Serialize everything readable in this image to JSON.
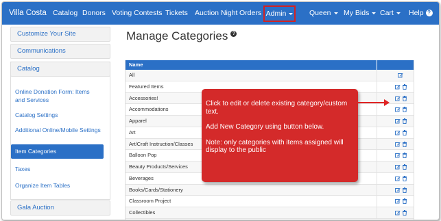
{
  "navbar": {
    "brand": "Villa Costa",
    "items": [
      "Catalog",
      "Donors",
      "Voting Contests",
      "Tickets",
      "Auction Night",
      "Orders"
    ],
    "admin": "Admin",
    "user": "Queen",
    "my_bids": "My Bids",
    "cart": "Cart",
    "help": "Help",
    "help_badge": "?"
  },
  "sidebar": {
    "sections": [
      "Customize Your Site",
      "Communications",
      "Catalog"
    ],
    "catalog_links": [
      "Online Donation Form: Items and Services",
      "Catalog Settings",
      "Additional Online/Mobile Settings",
      "Item Categories",
      "Taxes",
      "Organize Item Tables"
    ],
    "active_link": "Item Categories",
    "bottom_section": "Gala Auction"
  },
  "main": {
    "title": "Manage Categories",
    "title_badge": "?",
    "table": {
      "header": "Name",
      "rows": [
        "All",
        "Featured Items",
        "Accessories!",
        "Accommodations",
        "Apparel",
        "Art",
        "Art/Craft Instruction/Classes",
        "Balloon Pop",
        "Beauty Products/Services",
        "Beverages",
        "Books/Cards/Stationery",
        "Classroom Project",
        "Collectibles"
      ]
    }
  },
  "callout": {
    "line1": "Click to edit or delete existing category/custom text.",
    "line2": "Add New Category using button below.",
    "line3": "Note: only categories with items assigned will display to the public"
  },
  "colors": {
    "brand": "#2b70c6",
    "annotation": "#d42a2a",
    "highlight_border": "#d32222"
  },
  "icons": [
    "edit-icon",
    "trash-icon",
    "help-icon",
    "caret-down-icon"
  ]
}
